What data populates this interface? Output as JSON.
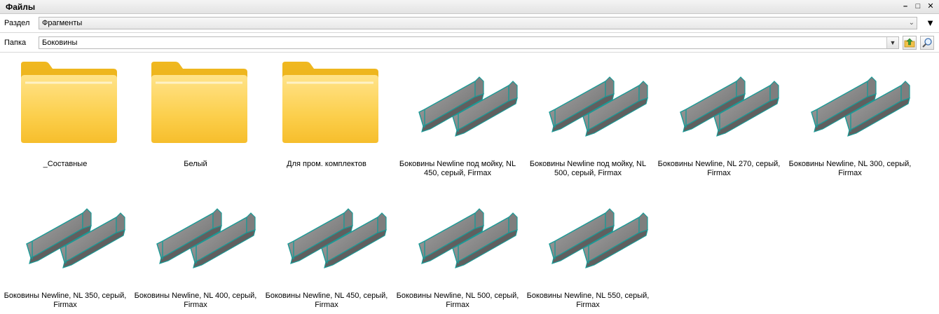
{
  "window": {
    "title": "Файлы",
    "min": "–",
    "max": "□",
    "close": "✕"
  },
  "section": {
    "label": "Раздел",
    "value": "Фрагменты",
    "filter_icon": "▼"
  },
  "folder": {
    "label": "Папка",
    "value": "Боковины"
  },
  "toolbar": {
    "up_icon": "folder-up-icon",
    "search_icon": "search-icon"
  },
  "items": [
    {
      "type": "folder",
      "name": "_Составные"
    },
    {
      "type": "folder",
      "name": "Белый"
    },
    {
      "type": "folder",
      "name": "Для пром. комплектов"
    },
    {
      "type": "part",
      "name": "Боковины Newline под мойку, NL 450, серый, Firmax"
    },
    {
      "type": "part",
      "name": "Боковины Newline под мойку, NL 500, серый, Firmax"
    },
    {
      "type": "part",
      "name": "Боковины Newline, NL 270, серый, Firmax"
    },
    {
      "type": "part",
      "name": "Боковины Newline, NL 300, серый, Firmax"
    },
    {
      "type": "part",
      "name": "Боковины Newline, NL 350, серый, Firmax"
    },
    {
      "type": "part",
      "name": "Боковины Newline, NL 400, серый, Firmax"
    },
    {
      "type": "part",
      "name": "Боковины Newline, NL 450, серый, Firmax"
    },
    {
      "type": "part",
      "name": "Боковины Newline, NL 500, серый, Firmax"
    },
    {
      "type": "part",
      "name": "Боковины Newline, NL 550, серый, Firmax"
    }
  ],
  "colors": {
    "folder": "#f8c840",
    "part_fill": "#8f8f8f",
    "part_edge": "#1a9a96"
  }
}
